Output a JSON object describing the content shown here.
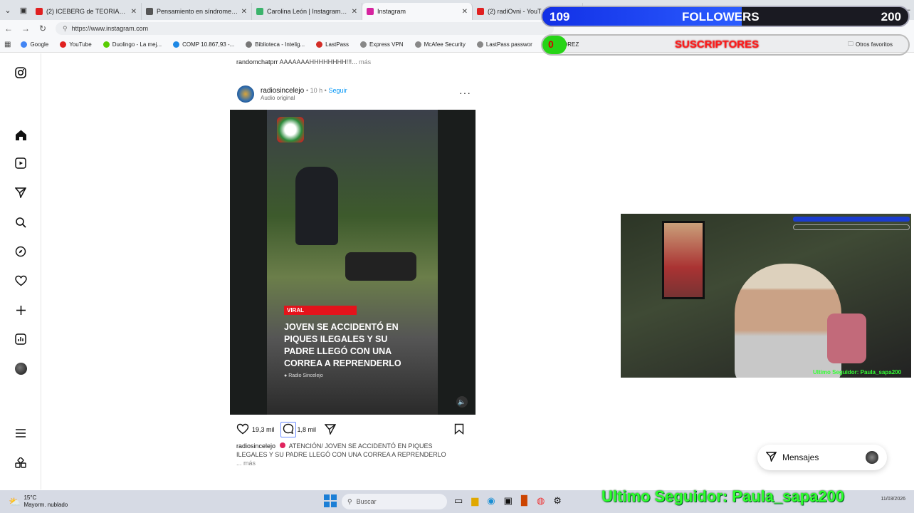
{
  "browser": {
    "tabs": [
      {
        "label": "(2) ICEBERG de TEORIAS IMPACTA",
        "color": "#e02020",
        "active": false
      },
      {
        "label": "Pensamiento en síndrome de Do",
        "color": "#555555",
        "active": false
      },
      {
        "label": "Carolina León | Instagram | Linkt",
        "color": "#3bb36b",
        "active": false
      },
      {
        "label": "Instagram",
        "color": "#d6249f",
        "active": true
      },
      {
        "label": "(2) radiOvni - YouT",
        "color": "#e02020",
        "active": false
      }
    ],
    "url": "https://www.instagram.com",
    "bookmarks": [
      {
        "label": "Google",
        "color": "#4285f4"
      },
      {
        "label": "YouTube",
        "color": "#e02020"
      },
      {
        "label": "Duolingo - La mej...",
        "color": "#58cc02"
      },
      {
        "label": "COMP 10.867,93 -...",
        "color": "#1e88e5"
      },
      {
        "label": "Biblioteca - Intelig...",
        "color": "#777777"
      },
      {
        "label": "LastPass",
        "color": "#d32d27"
      },
      {
        "label": "Express VPN",
        "color": "#888888"
      },
      {
        "label": "McAfee Security",
        "color": "#888888"
      },
      {
        "label": "LastPass passwor",
        "color": "#888888"
      },
      {
        "label": "AJEDREZ",
        "color": "#888888"
      }
    ],
    "other_favs": "Otros favoritos"
  },
  "feed": {
    "prev_caption_user": "randomchatprr",
    "prev_caption_text": "AAAAAAAHHHHHHHH!!!...",
    "more": "más",
    "post": {
      "username": "radiosincelejo",
      "time": "• 10 h •",
      "follow": "Seguir",
      "audio": "Audio original",
      "viral_tag": "VIRAL",
      "headline": "JOVEN SE ACCIDENTÓ EN PIQUES ILEGALES Y SU PADRE LLEGÓ CON UNA CORREA A REPRENDERLO",
      "credit": "Radio Sincelejo",
      "likes": "19,3 mil",
      "comments": "1,8 mil",
      "caption_user": "radiosincelejo",
      "caption_text": "ATENCIÓN/ JOVEN SE ACCIDENTÓ EN PIQUES ILEGALES Y SU PADRE LLEGÓ CON UNA CORREA A REPRENDERLO",
      "caption_more": "... más"
    }
  },
  "overlay": {
    "followers_count": "109",
    "followers_label": "FOLLOWERS",
    "followers_goal": "200",
    "subs_count": "0",
    "subs_label": "SUSCRIPTORES",
    "followers_progress": 0.545,
    "last_follower": "Ultimo Seguidor: Paula_sapa200",
    "cam_last_follower": "Ultimo Seguidor: Paula_sapa200"
  },
  "messages": {
    "label": "Mensajes"
  },
  "taskbar": {
    "weather_temp": "15°C",
    "weather_desc": "Mayorm. nublado",
    "search_placeholder": "Buscar",
    "date": "11/03/2026"
  }
}
